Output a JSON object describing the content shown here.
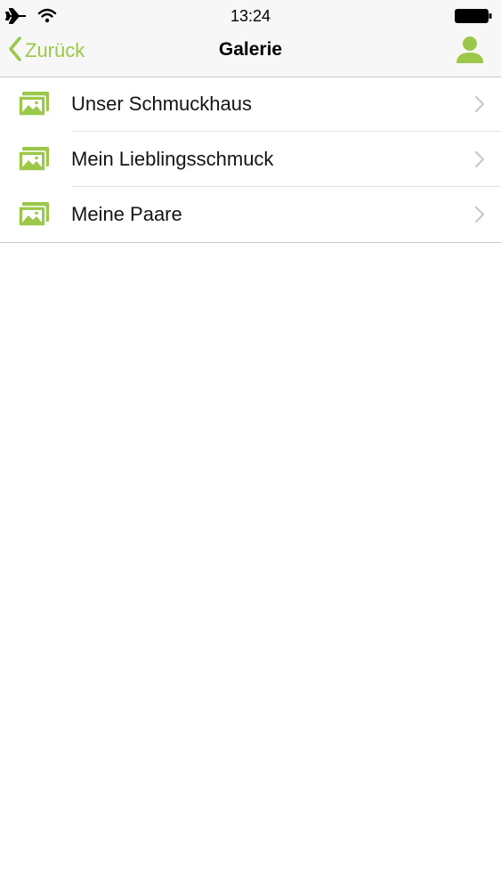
{
  "status_bar": {
    "time": "13:24",
    "icons": [
      "airplane-icon",
      "wifi-icon",
      "battery-icon"
    ]
  },
  "nav": {
    "back_label": "Zurück",
    "title": "Galerie",
    "right_icon": "user-icon"
  },
  "gallery": {
    "items": [
      {
        "label": "Unser Schmuckhaus",
        "icon": "gallery-icon"
      },
      {
        "label": "Mein Lieblingsschmuck",
        "icon": "gallery-icon"
      },
      {
        "label": "Meine Paare",
        "icon": "gallery-icon"
      }
    ]
  },
  "colors": {
    "accent": "#9cc84a",
    "navbar_bg": "#f7f7f7",
    "separator": "#e2e2e2",
    "chevron": "#c7c7cc"
  }
}
